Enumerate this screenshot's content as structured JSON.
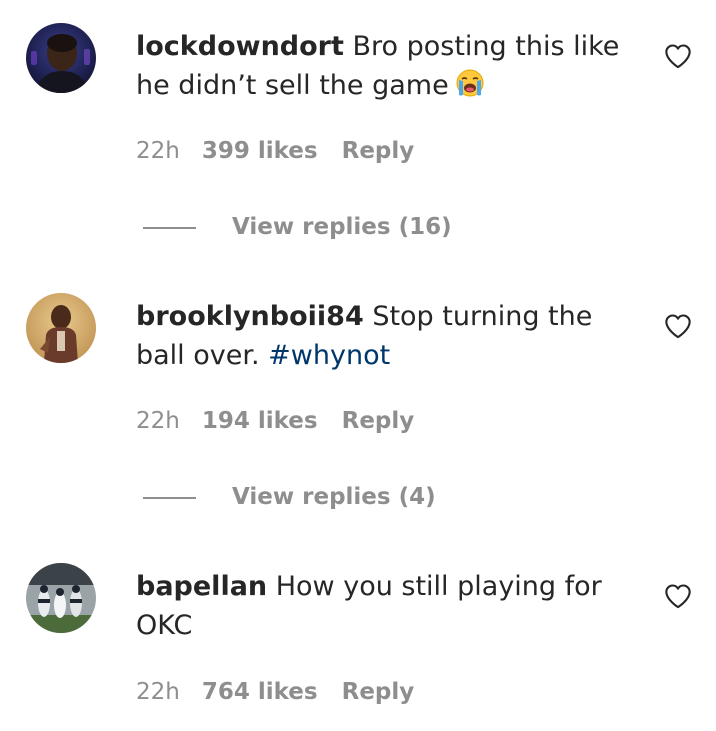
{
  "comments": [
    {
      "username": "lockdowndort",
      "text": " Bro posting this like he didn’t sell the game",
      "emoji": "loudly-crying-face-emoji",
      "time": "22h",
      "likes": "399 likes",
      "reply": "Reply",
      "view_replies": "View replies (16)"
    },
    {
      "username": "brooklynboii84",
      "text": " Stop turning the ball over. ",
      "hashtag": "#whynot",
      "time": "22h",
      "likes": "194 likes",
      "reply": "Reply",
      "view_replies": "View replies (4)"
    },
    {
      "username": "bapellan",
      "text": " How you still playing for OKC",
      "time": "22h",
      "likes": "764 likes",
      "reply": "Reply"
    }
  ],
  "icons": {
    "like": "heart-outline-icon"
  },
  "colors": {
    "text": "#262626",
    "secondary": "#8e8e8e",
    "hashtag": "#00376b"
  }
}
